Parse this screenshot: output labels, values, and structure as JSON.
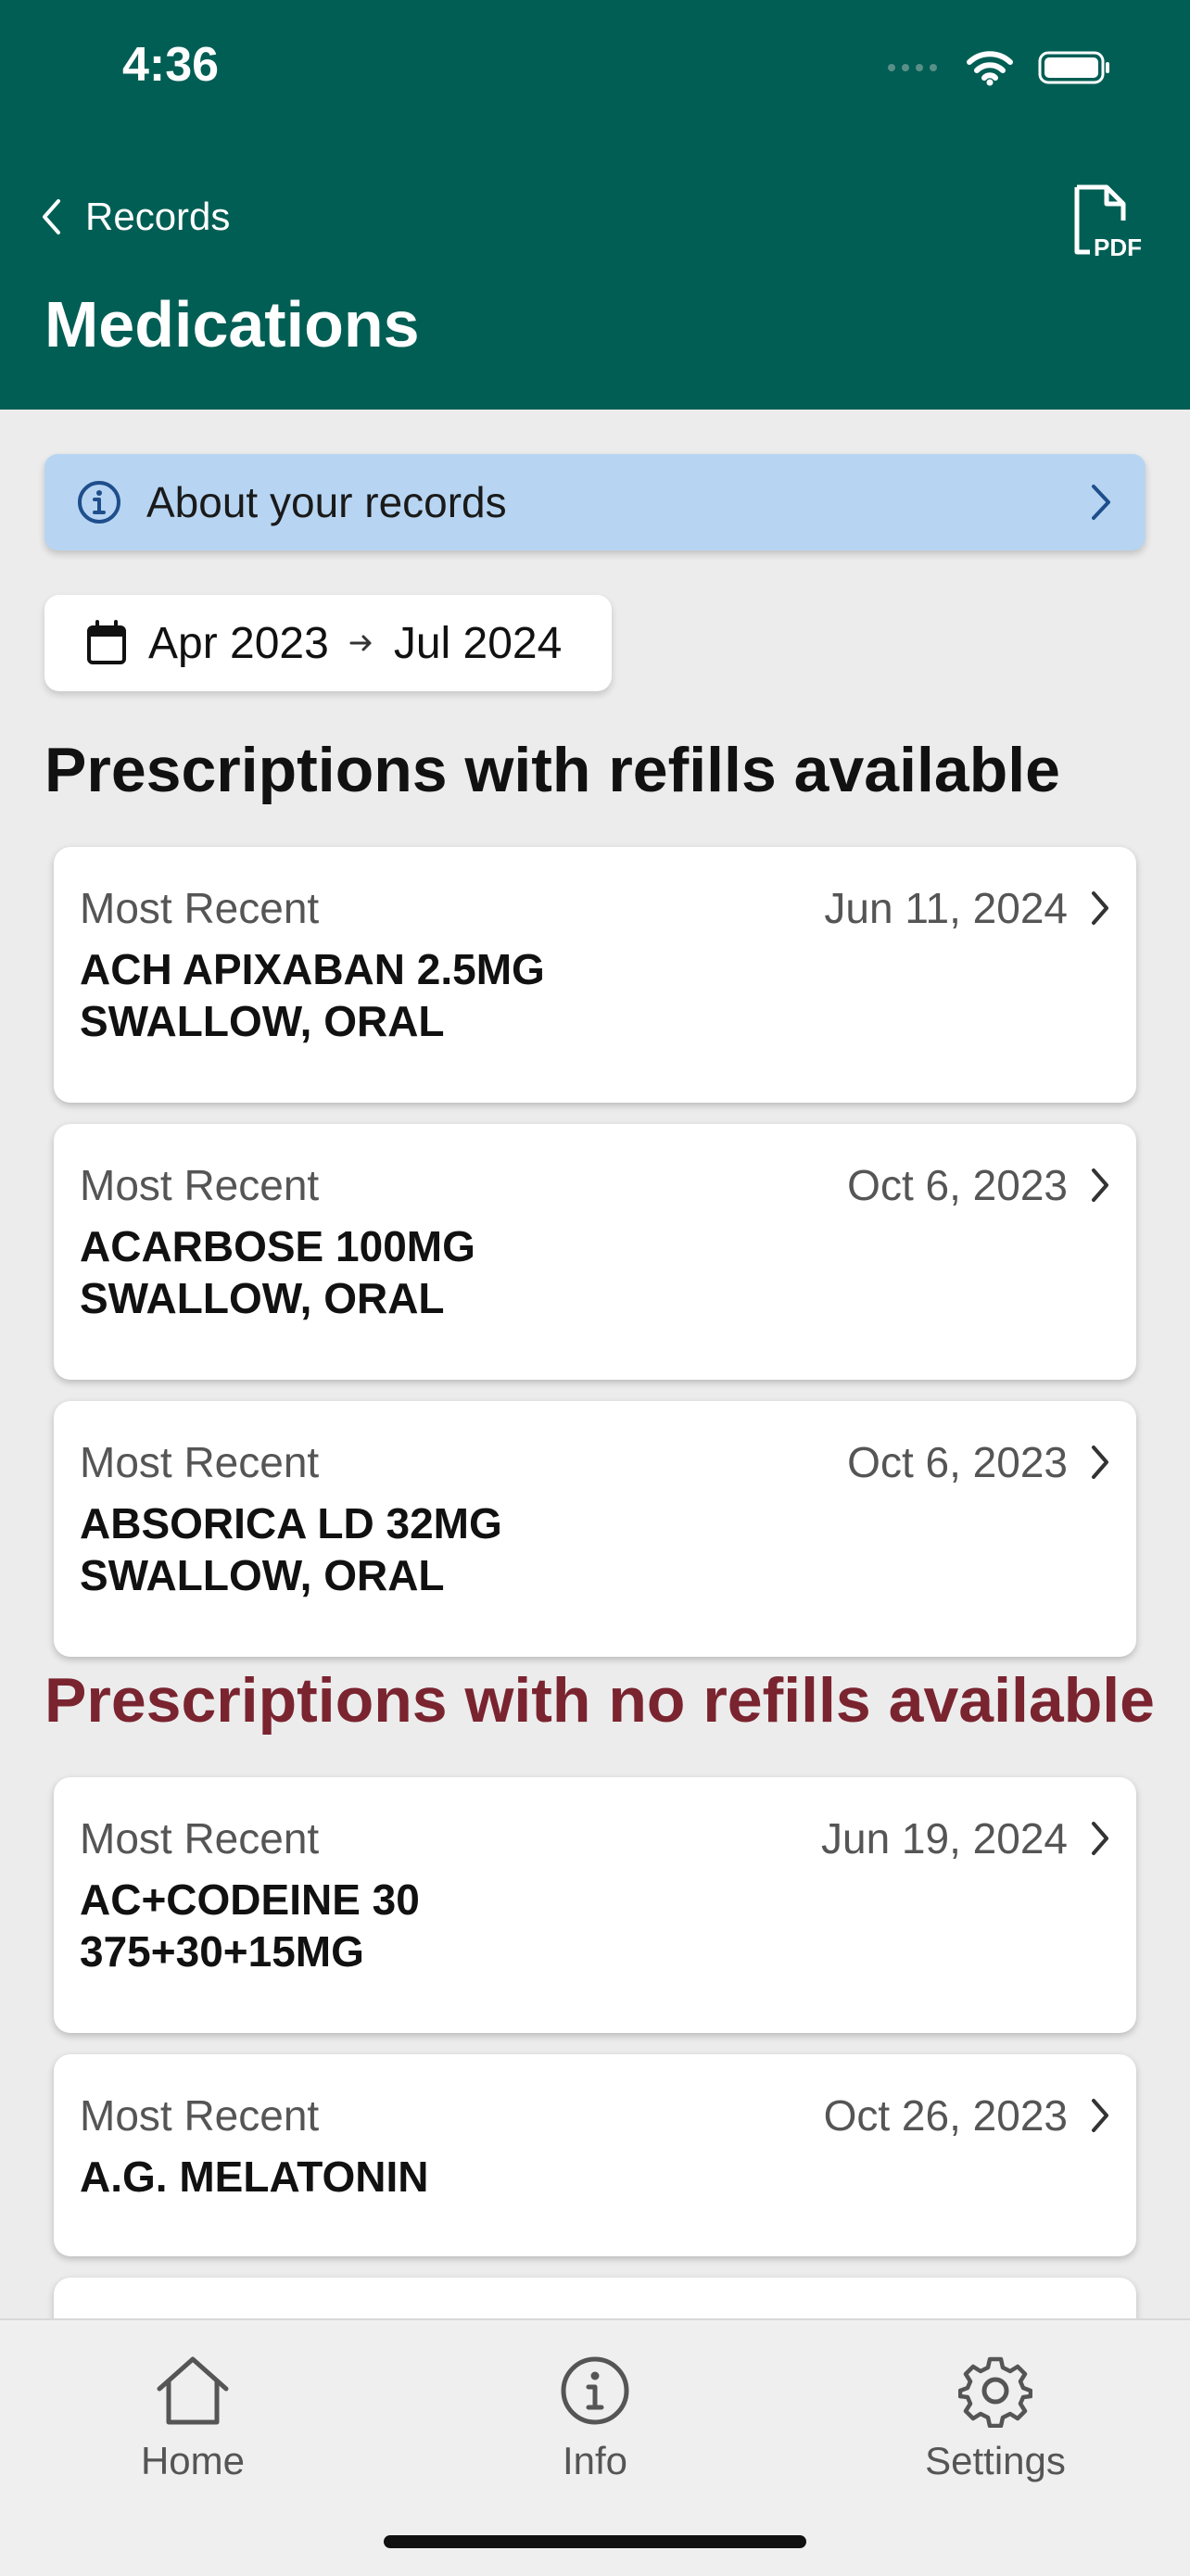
{
  "status_bar": {
    "time": "4:36"
  },
  "nav": {
    "back_label": "Records",
    "title": "Medications",
    "pdf_icon": "pdf-file-icon"
  },
  "info_banner": {
    "label": "About your records"
  },
  "date_range": {
    "start": "Apr 2023",
    "end": "Jul 2024"
  },
  "sections": {
    "refills_available": {
      "title": "Prescriptions with refills available",
      "items": [
        {
          "kicker": "Most Recent",
          "date": "Jun 11, 2024",
          "name_line1": "ACH APIXABAN 2.5MG",
          "name_line2": "SWALLOW, ORAL"
        },
        {
          "kicker": "Most Recent",
          "date": "Oct 6, 2023",
          "name_line1": "ACARBOSE 100MG",
          "name_line2": "SWALLOW, ORAL"
        },
        {
          "kicker": "Most Recent",
          "date": "Oct 6, 2023",
          "name_line1": "ABSORICA LD 32MG",
          "name_line2": "SWALLOW, ORAL"
        }
      ]
    },
    "no_refills": {
      "title": "Prescriptions with no refills available",
      "title_color": "#7a2430",
      "items": [
        {
          "kicker": "Most Recent",
          "date": "Jun 19, 2024",
          "name_line1": "AC+CODEINE 30",
          "name_line2": "375+30+15MG"
        },
        {
          "kicker": "Most Recent",
          "date": "Oct 26, 2023",
          "name_line1": "A.G. MELATONIN"
        }
      ]
    }
  },
  "tab_bar": {
    "tabs": [
      {
        "label": "Home",
        "icon": "home-icon"
      },
      {
        "label": "Info",
        "icon": "info-icon"
      },
      {
        "label": "Settings",
        "icon": "gear-icon"
      }
    ]
  },
  "colors": {
    "header": "#005e54",
    "banner": "#b7d5f2",
    "no_refill_title": "#7a2430"
  }
}
